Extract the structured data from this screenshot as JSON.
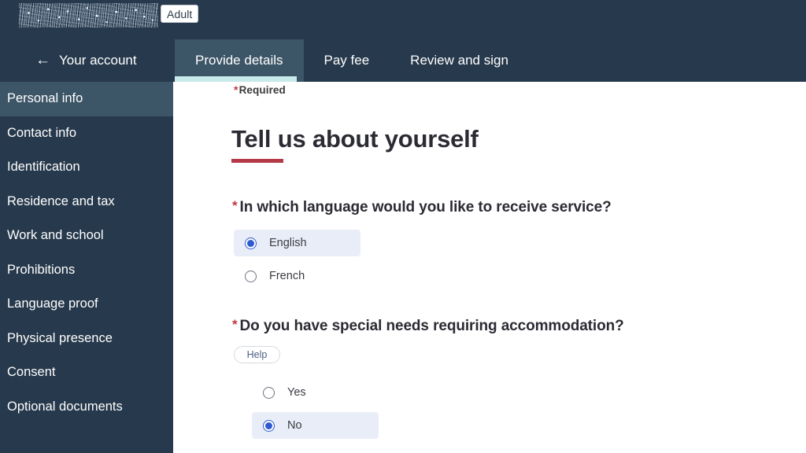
{
  "header": {
    "brand_redacted_label": "redacted-application-title",
    "badge": "Adult",
    "back_link": "Your account",
    "back_arrow_icon": "arrow-left-icon",
    "tabs": [
      {
        "label": "Provide details",
        "active": true
      },
      {
        "label": "Pay fee",
        "active": false
      },
      {
        "label": "Review and sign",
        "active": false
      }
    ]
  },
  "sidebar": {
    "items": [
      {
        "label": "Personal info",
        "active": true
      },
      {
        "label": "Contact info",
        "active": false
      },
      {
        "label": "Identification",
        "active": false
      },
      {
        "label": "Residence and tax",
        "active": false
      },
      {
        "label": "Work and school",
        "active": false
      },
      {
        "label": "Prohibitions",
        "active": false
      },
      {
        "label": "Language proof",
        "active": false
      },
      {
        "label": "Physical presence",
        "active": false
      },
      {
        "label": "Consent",
        "active": false
      },
      {
        "label": "Optional documents",
        "active": false
      }
    ]
  },
  "main": {
    "required_star": "*",
    "required_note": "Required",
    "page_title": "Tell us about yourself",
    "questions": [
      {
        "star": "*",
        "text": "In which language would you like to receive service?",
        "options": [
          {
            "label": "English",
            "selected": true
          },
          {
            "label": "French",
            "selected": false
          }
        ]
      },
      {
        "star": "*",
        "text": "Do you have special needs requiring accommodation?",
        "help_label": "Help",
        "options": [
          {
            "label": "Yes",
            "selected": false
          },
          {
            "label": "No",
            "selected": true
          }
        ]
      }
    ]
  },
  "colors": {
    "header_bg": "#27394c",
    "active_tab_bg": "#3c5567",
    "tab_underline": "#c8eaea",
    "accent_red": "#b53a47",
    "radio_blue": "#2f5bd0",
    "selected_row_bg": "#e9edf7"
  }
}
